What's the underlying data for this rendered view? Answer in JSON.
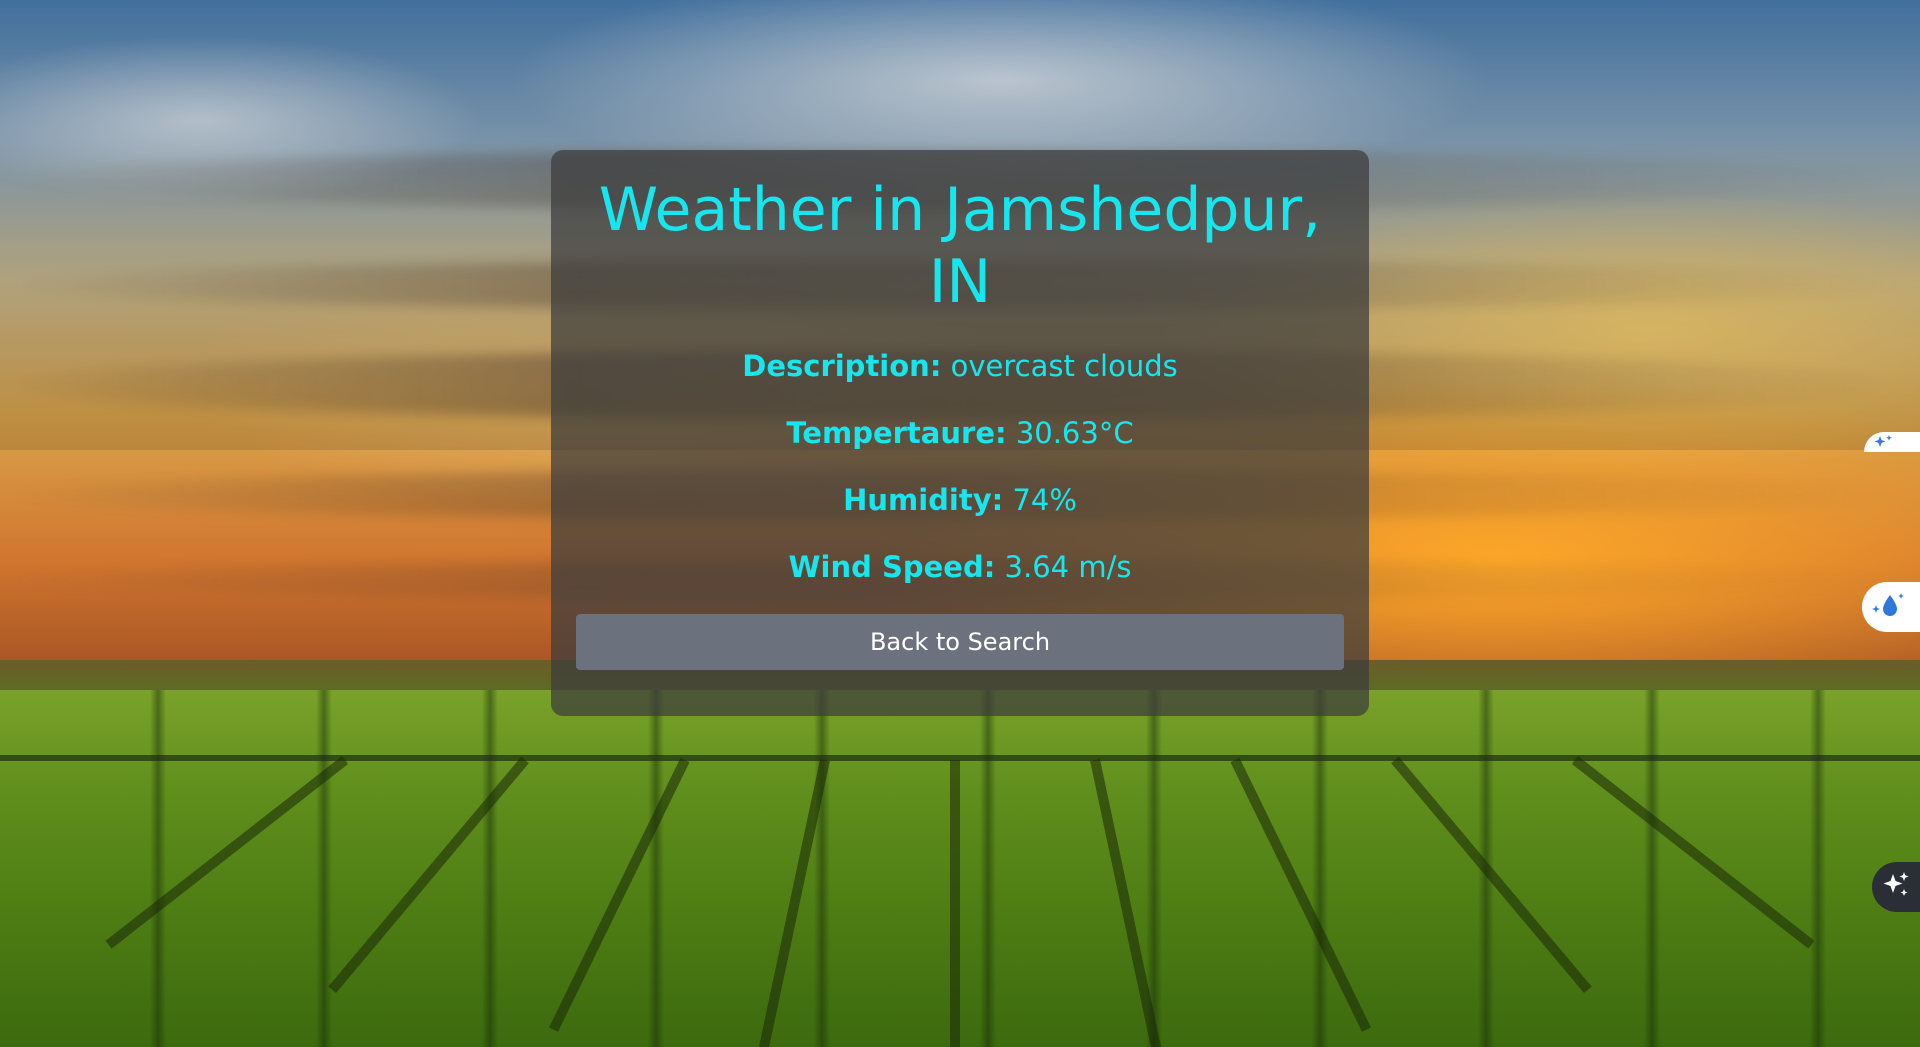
{
  "weather": {
    "title": "Weather in Jamshedpur, IN",
    "rows": [
      {
        "label": "Description:",
        "value": "overcast clouds"
      },
      {
        "label": "Tempertaure:",
        "value": "30.63°C"
      },
      {
        "label": "Humidity:",
        "value": "74%"
      },
      {
        "label": "Wind Speed:",
        "value": "3.64 m/s"
      }
    ],
    "back_button_label": "Back to Search"
  },
  "colors": {
    "accent_text": "#16e6ee",
    "button_bg": "#6b727d",
    "card_bg": "rgba(60,60,60,0.72)"
  },
  "side_widgets": [
    {
      "icon": "sparkle-icon"
    },
    {
      "icon": "water-drop-sparkle-icon"
    },
    {
      "icon": "ai-sparkle-icon"
    }
  ]
}
